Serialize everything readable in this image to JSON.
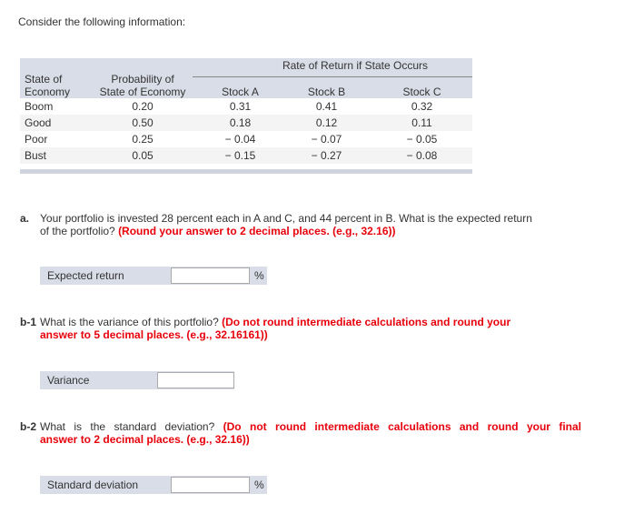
{
  "intro": "Consider the following information:",
  "table": {
    "group_header": "Rate of Return if State Occurs",
    "columns": [
      [
        "State of",
        "Economy"
      ],
      [
        "Probability of",
        "State of Economy"
      ],
      [
        "Stock A"
      ],
      [
        "Stock B"
      ],
      [
        "Stock C"
      ]
    ],
    "rows": [
      {
        "state": "Boom",
        "probability": "0.20",
        "stock_a": "0.31",
        "stock_b": "0.41",
        "stock_c": "0.32"
      },
      {
        "state": "Good",
        "probability": "0.50",
        "stock_a": "0.18",
        "stock_b": "0.12",
        "stock_c": "0.11"
      },
      {
        "state": "Poor",
        "probability": "0.25",
        "stock_a": "−  0.04",
        "stock_b": "−  0.07",
        "stock_c": "−  0.05"
      },
      {
        "state": "Bust",
        "probability": "0.05",
        "stock_a": "−  0.15",
        "stock_b": "−  0.27",
        "stock_c": "−  0.08"
      }
    ]
  },
  "questions": {
    "a": {
      "label": "a.",
      "line1": "Your portfolio is invested 28 percent each in A and C, and 44 percent in B. What is the expected return",
      "line2_plain": "of the portfolio? ",
      "line2_red": "(Round your answer to 2 decimal places. (e.g., 32.16))",
      "field_label": "Expected return",
      "field_value": "",
      "unit": "%"
    },
    "b1": {
      "label": "b-1",
      "line1_plain": "What is the variance of this portfolio? ",
      "line1_red": "(Do not round intermediate calculations and round your",
      "line2_red": "answer to 5 decimal places. (e.g., 32.16161))",
      "field_label": "Variance",
      "field_value": ""
    },
    "b2": {
      "label": "b-2",
      "line1_plain": "What is the standard deviation? ",
      "line1_red": "(Do not round intermediate calculations and round your final",
      "line2_red": "answer to 2 decimal places. (e.g., 32.16))",
      "field_label": "Standard deviation",
      "field_value": "",
      "unit": "%"
    }
  },
  "colors": {
    "instruction_red": "#e8000b",
    "table_header_bg": "#d9dde7",
    "row_alt_bg": "#f4f4f4"
  }
}
